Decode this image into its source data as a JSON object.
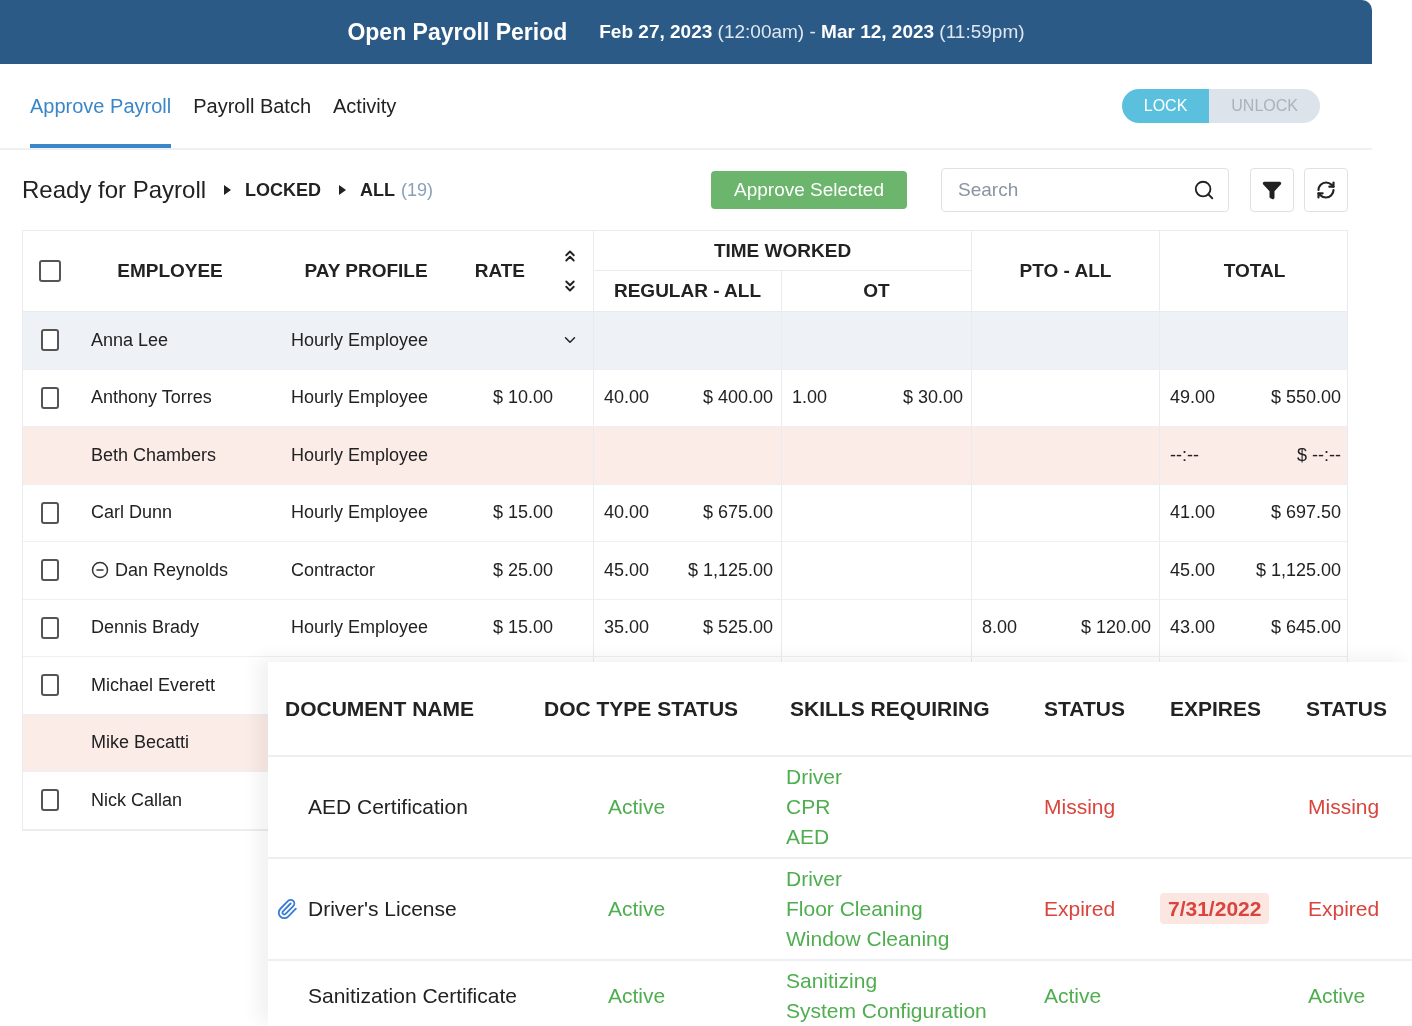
{
  "period_bar": {
    "title": "Open Payroll Period",
    "range": "**Feb 27, 2023** (12:00am) - **Mar 12, 2023** (11:59pm)"
  },
  "tabs": [
    {
      "label": "Approve Payroll",
      "selected": true
    },
    {
      "label": "Payroll Batch",
      "selected": false
    },
    {
      "label": "Activity",
      "selected": false
    }
  ],
  "lock_toggle": [
    {
      "label": "LOCK",
      "selected": true
    },
    {
      "label": "UNLOCK",
      "selected": false
    }
  ],
  "breadcrumb": {
    "title": "Ready for Payroll",
    "steps": [
      {
        "label": "LOCKED"
      },
      {
        "label": "ALL",
        "count": "(19)"
      }
    ]
  },
  "approve_button": "Approve Selected",
  "search": {
    "placeholder": "Search"
  },
  "table": {
    "select_all": {
      "checked": false
    },
    "columns": {
      "employee": "EMPLOYEE",
      "pay_profile": "PAY PROFILE",
      "rate": "RATE",
      "time_worked": "TIME WORKED",
      "regular": "REGULAR - ALL",
      "ot": "OT",
      "pto": "PTO - ALL",
      "total": "TOTAL"
    },
    "rows": [
      {
        "name": "Anna Lee",
        "profile": "Hourly Employee",
        "checked": false,
        "selected": true,
        "flagged": false,
        "expandable": true,
        "excluded": false,
        "cells": {}
      },
      {
        "name": "Anthony Torres",
        "profile": "Hourly Employee",
        "checked": false,
        "selected": false,
        "flagged": false,
        "expandable": false,
        "excluded": false,
        "cells": {
          "rate": "$ 10.00",
          "reg_hours": "40.00",
          "reg_amount": "$ 400.00",
          "ot_hours": "1.00",
          "ot_amount": "$ 30.00",
          "total_hours": "49.00",
          "total_amount": "$ 550.00"
        }
      },
      {
        "name": "Beth Chambers",
        "profile": "Hourly Employee",
        "selected": false,
        "flagged": true,
        "expandable": false,
        "excluded": false,
        "cells": {
          "total_hours": "--:--",
          "total_amount": "$ --:--"
        }
      },
      {
        "name": "Carl Dunn",
        "profile": "Hourly Employee",
        "checked": false,
        "selected": false,
        "flagged": false,
        "expandable": false,
        "excluded": false,
        "cells": {
          "rate": "$ 15.00",
          "reg_hours": "40.00",
          "reg_amount": "$ 675.00",
          "total_hours": "41.00",
          "total_amount": "$ 697.50"
        }
      },
      {
        "name": "Dan Reynolds",
        "profile": "Contractor",
        "checked": false,
        "selected": false,
        "flagged": false,
        "expandable": false,
        "excluded": true,
        "cells": {
          "rate": "$ 25.00",
          "reg_hours": "45.00",
          "reg_amount": "$ 1,125.00",
          "total_hours": "45.00",
          "total_amount": "$ 1,125.00"
        }
      },
      {
        "name": "Dennis Brady",
        "profile": "Hourly Employee",
        "checked": false,
        "selected": false,
        "flagged": false,
        "expandable": false,
        "excluded": false,
        "cells": {
          "rate": "$ 15.00",
          "reg_hours": "35.00",
          "reg_amount": "$ 525.00",
          "pto_hours": "8.00",
          "pto_amount": "$ 120.00",
          "total_hours": "43.00",
          "total_amount": "$ 645.00"
        }
      },
      {
        "name": "Michael Everett",
        "checked": false,
        "selected": false,
        "flagged": false,
        "excluded": false,
        "cells": {}
      },
      {
        "name": "Mike Becatti",
        "selected": false,
        "flagged": true,
        "excluded": false,
        "cells": {}
      },
      {
        "name": "Nick Callan",
        "checked": false,
        "selected": false,
        "flagged": false,
        "excluded": false,
        "cells": {}
      }
    ]
  },
  "documents": {
    "columns": [
      "DOCUMENT NAME",
      "DOC TYPE STATUS",
      "SKILLS REQUIRING",
      "STATUS",
      "EXPIRES",
      "STATUS"
    ],
    "rows": [
      {
        "name": "AED Certification",
        "attachment": false,
        "doc_type_status": {
          "text": "Active",
          "color": "#4fae4f"
        },
        "skills": [
          "Driver",
          "CPR",
          "AED"
        ],
        "status": {
          "text": "Missing",
          "color": "#d9443c"
        },
        "status_2": {
          "text": "Missing",
          "color": "#d9443c"
        }
      },
      {
        "name": "Driver's License",
        "attachment": true,
        "doc_type_status": {
          "text": "Active",
          "color": "#4fae4f"
        },
        "skills": [
          "Driver",
          "Floor Cleaning",
          "Window Cleaning"
        ],
        "status": {
          "text": "Expired",
          "color": "#d9443c"
        },
        "expires": {
          "text": "7/31/2022",
          "flagged": true
        },
        "status_2": {
          "text": "Expired",
          "color": "#d9443c"
        }
      },
      {
        "name": "Sanitization Certificate",
        "attachment": false,
        "doc_type_status": {
          "text": "Active",
          "color": "#4fae4f"
        },
        "skills": [
          "Sanitizing",
          "System Configuration"
        ],
        "status": {
          "text": "Active",
          "color": "#4fae4f"
        },
        "status_2": {
          "text": "Active",
          "color": "#4fae4f"
        }
      }
    ]
  }
}
